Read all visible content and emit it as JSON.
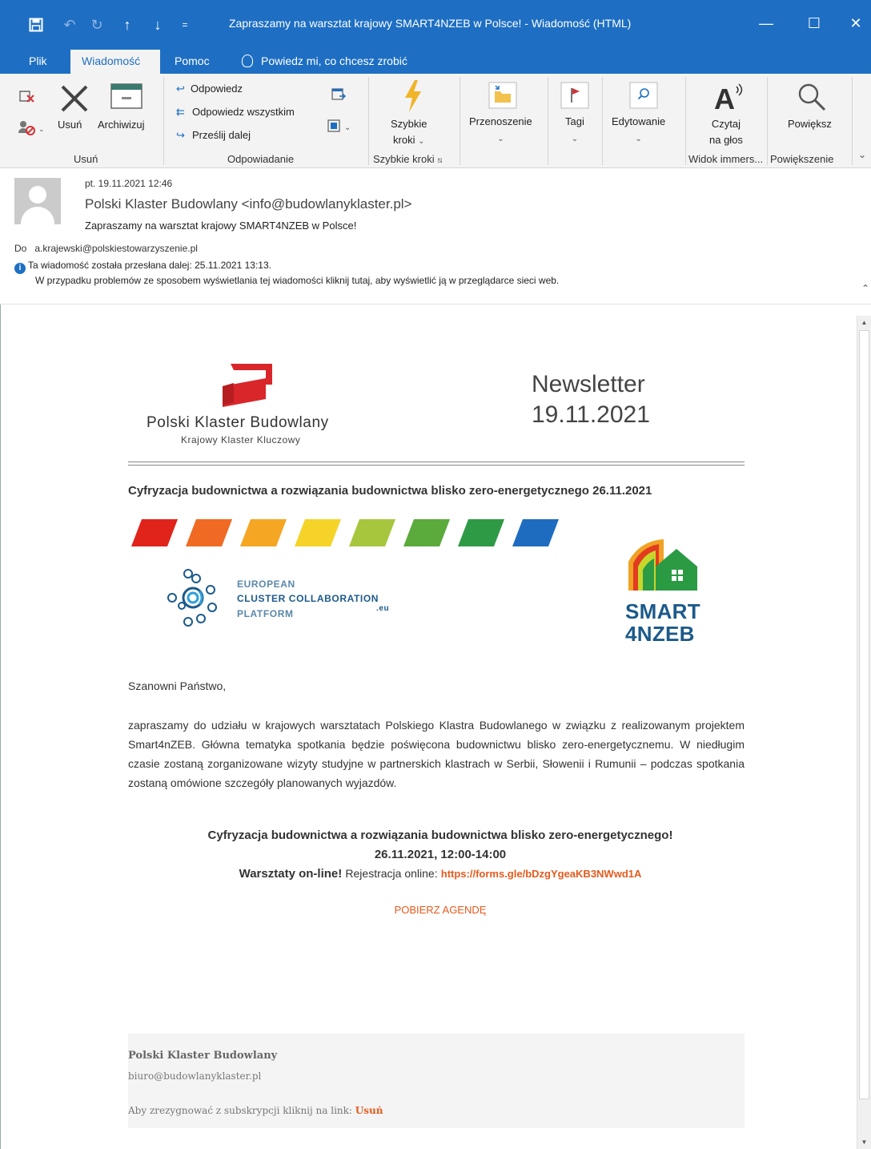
{
  "window": {
    "title": "Zapraszamy na warsztat krajowy SMART4NZEB w Polsce!  -  Wiadomość (HTML)",
    "qat_icons": [
      "save-icon",
      "undo-icon",
      "redo-icon",
      "previous-item-icon",
      "next-item-icon",
      "customize-qat-icon"
    ],
    "controls": {
      "minimize": "—",
      "maximize": "☐",
      "close": "✕"
    }
  },
  "tabs": {
    "file": "Plik",
    "message": "Wiadomość",
    "help": "Pomoc",
    "tell_me": "Powiedz mi, co chcesz zrobić"
  },
  "ribbon": {
    "delete_group": {
      "label": "Usuń",
      "delete": "Usuń",
      "archive": "Archiwizuj"
    },
    "respond_group": {
      "label": "Odpowiadanie",
      "reply": "Odpowiedz",
      "reply_all": "Odpowiedz wszystkim",
      "forward": "Prześlij dalej"
    },
    "quick_steps_group": {
      "label": "Szybkie kroki",
      "button_line1": "Szybkie",
      "button_line2": "kroki"
    },
    "move": "Przenoszenie",
    "tags": "Tagi",
    "editing": "Edytowanie",
    "immersive_group": {
      "label": "Widok immers...",
      "read_line1": "Czytaj",
      "read_line2": "na głos"
    },
    "zoom_group": {
      "label": "Powiększenie",
      "zoom": "Powiększ"
    }
  },
  "message": {
    "date": "pt. 19.11.2021 12:46",
    "from": "Polski Klaster Budowlany <info@budowlanyklaster.pl>",
    "subject": "Zapraszamy na warsztat krajowy SMART4NZEB w Polsce!",
    "to_label": "Do",
    "to": "a.krajewski@polskiestowarzyszenie.pl",
    "forwarded_info": "Ta wiadomość została przesłana dalej: 25.11.2021 13:13.",
    "display_info": "W przypadku problemów ze sposobem wyświetlania tej wiadomości kliknij tutaj, aby wyświetlić ją w przeglądarce sieci web."
  },
  "newsletter": {
    "logo_name": "Polski Klaster Budowlany",
    "logo_sub": "Krajowy Klaster Kluczowy",
    "title_line1": "Newsletter",
    "title_line2": "19.11.2021",
    "heading": "Cyfryzacja budownictwa a rozwiązania budownictwa blisko zero-energetycznego 26.11.2021",
    "stripe_colors": [
      "#e0241b",
      "#f06a23",
      "#f5a623",
      "#f5d328",
      "#a6c73d",
      "#5aaa3c",
      "#2f9a45",
      "#1e6cc0"
    ],
    "ecc": {
      "line1": "EUROPEAN",
      "line2": "CLUSTER COLLABORATION",
      "line3": "PLATFORM",
      "suffix": ".eu"
    },
    "smart_logo": {
      "line1": "SMART",
      "line2": "4NZEB"
    },
    "greeting": "Szanowni Państwo,",
    "body": "zapraszamy do udziału w krajowych warsztatach Polskiego Klastra Budowlanego w związku z realizowanym projektem Smart4nZEB. Główna tematyka spotkania będzie poświęcona budownictwu blisko zero-energetycznemu. W niedługim czasie zostaną zorganizowane wizyty studyjne w partnerskich klastrach w Serbii, Słowenii i Rumunii – podczas spotkania zostaną omówione szczegóły planowanych wyjazdów.",
    "event_title": "Cyfryzacja budownictwa a rozwiązania budownictwa blisko zero-energetycznego!",
    "event_date": "26.11.2021, 12:00-14:00",
    "event_online": "Warsztaty on-line!",
    "event_reg_label": "Rejestracja online:",
    "event_reg_link": "https://forms.gle/bDzgYgeaKB3NWwd1A",
    "agenda_link": "POBIERZ AGENDĘ",
    "footer": {
      "name": "Polski Klaster Budowlany",
      "email": "biuro@budowlanyklaster.pl",
      "unsubscribe_text": "Aby zrezygnować z subskrypcji kliknij na link:",
      "unsubscribe_link": "Usuń"
    }
  },
  "colors": {
    "titlebar": "#1e6fc3",
    "ribbon": "#f3f3f3",
    "link": "#e55a1c",
    "brand_red": "#d9262a",
    "smart_navy": "#1c5a8a"
  }
}
